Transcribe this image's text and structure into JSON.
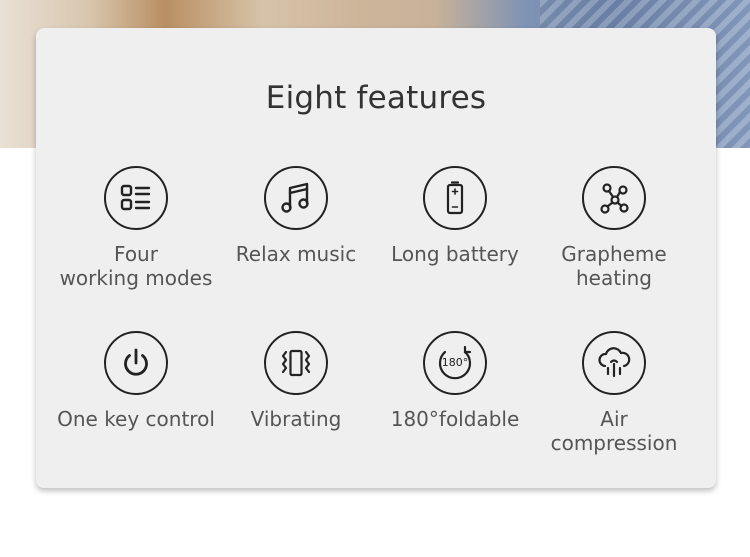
{
  "header": {
    "title": "Eight features"
  },
  "features": [
    {
      "label": "Four\nworking modes",
      "icon": "list-grid-icon"
    },
    {
      "label": "Relax music",
      "icon": "music-note-icon"
    },
    {
      "label": "Long battery",
      "icon": "battery-icon"
    },
    {
      "label": "Grapheme\nheating",
      "icon": "graphene-molecule-icon"
    },
    {
      "label": "One key control",
      "icon": "power-icon"
    },
    {
      "label": "Vibrating",
      "icon": "vibration-icon"
    },
    {
      "label": "180°foldable",
      "icon": "rotate-180-icon"
    },
    {
      "label": "Air\ncompression",
      "icon": "air-cloud-icon"
    }
  ],
  "colors": {
    "card_bg": "#efefef",
    "icon_stroke": "#222222",
    "text": "#555555",
    "title": "#333333"
  }
}
